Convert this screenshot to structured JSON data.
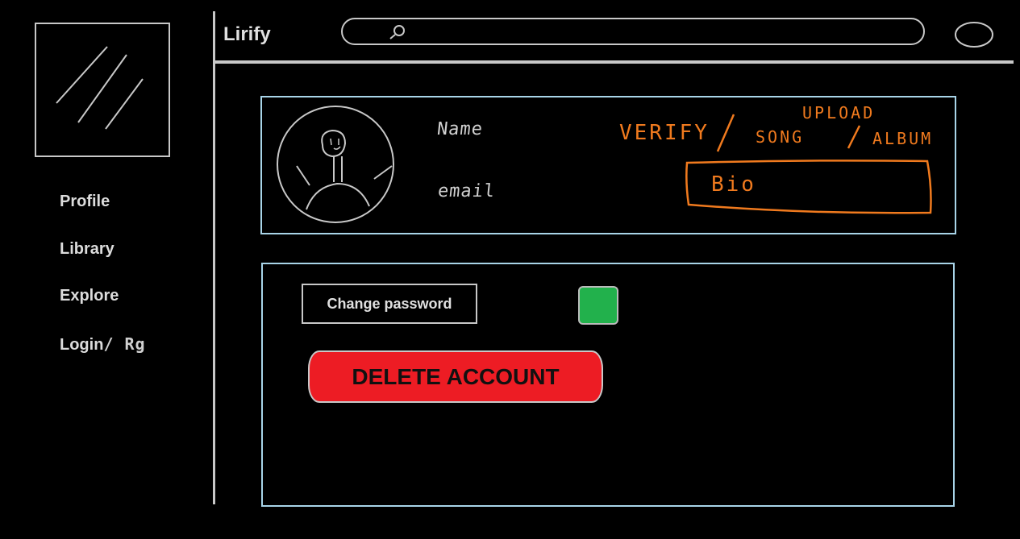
{
  "app": {
    "title": "Lirify"
  },
  "sidebar": {
    "items": [
      {
        "label": "Profile"
      },
      {
        "label": "Library"
      },
      {
        "label": "Explore"
      },
      {
        "label": "Login",
        "suffix": "/ Rg"
      }
    ]
  },
  "search": {
    "placeholder": ""
  },
  "profile": {
    "name_label": "Name",
    "email_label": "email",
    "verify_label": "VERIFY",
    "upload_label": "UPLOAD",
    "song_label": "SONG",
    "album_label": "ALBUM",
    "bio_label": "Bio"
  },
  "settings": {
    "change_password_label": "Change password",
    "delete_account_label": "DELETE ACCOUNT",
    "toggle_color": "#22b14c"
  },
  "colors": {
    "accent_panel": "#a8d4e8",
    "annotation": "#f07a1e",
    "danger": "#ed1c24"
  }
}
